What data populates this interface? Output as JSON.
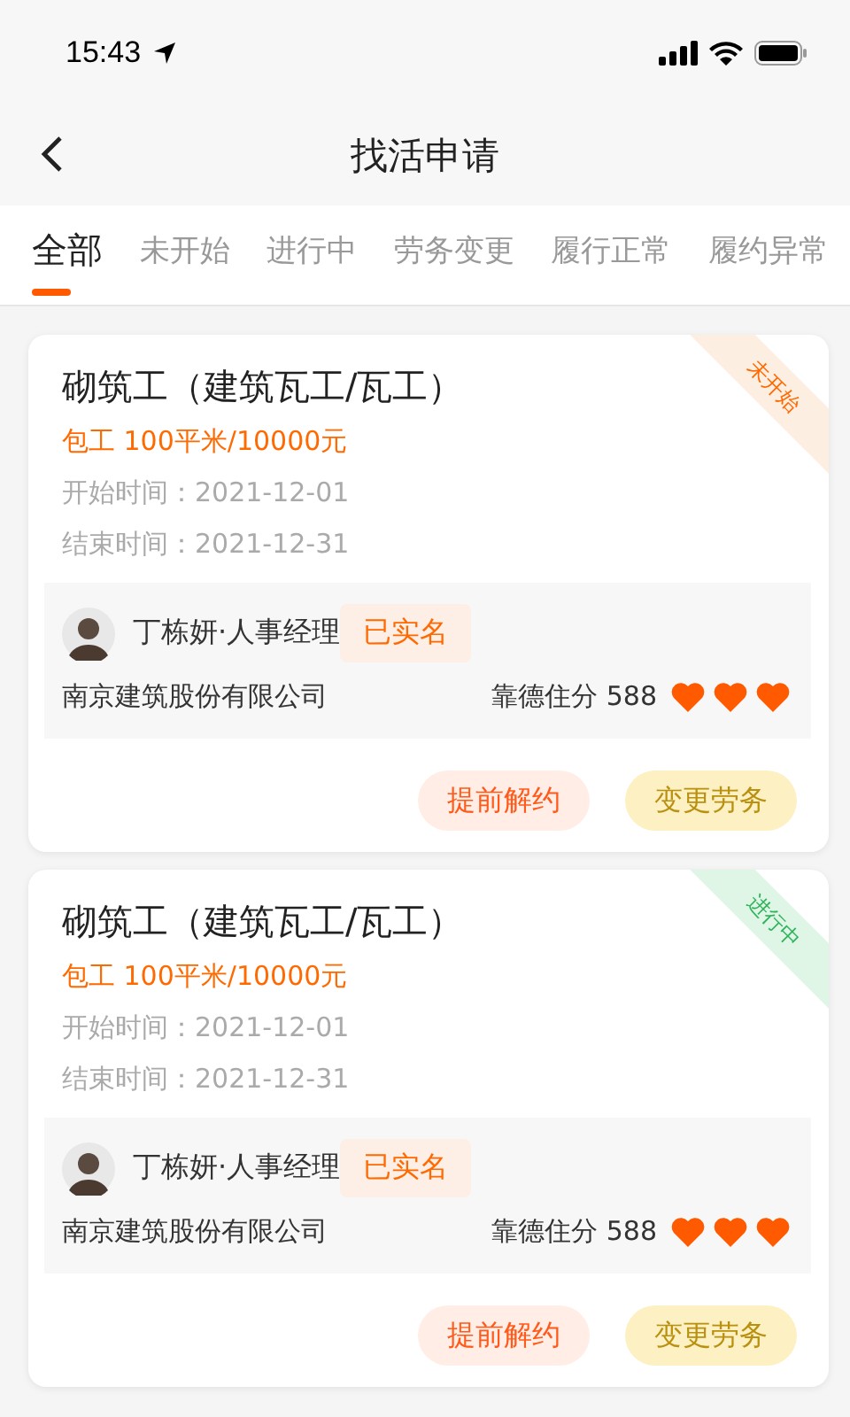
{
  "status_bar": {
    "time": "15:43"
  },
  "nav": {
    "title": "找活申请"
  },
  "tabs": [
    {
      "label": "全部",
      "selected": true
    },
    {
      "label": "未开始",
      "selected": false
    },
    {
      "label": "进行中",
      "selected": false
    },
    {
      "label": "劳务变更",
      "selected": false
    },
    {
      "label": "履行正常",
      "selected": false
    },
    {
      "label": "履约异常",
      "selected": false
    }
  ],
  "cards": [
    {
      "title": "砌筑工（建筑瓦工/瓦工）",
      "price": "包工 100平米/10000元",
      "start": "开始时间：2021-12-01",
      "end": "结束时间：2021-12-31",
      "status": {
        "label": "未开始",
        "kind": "pending"
      },
      "contact": "丁栋妍·人事经理",
      "badge": "已实名",
      "company": "南京建筑股份有限公司",
      "score": "靠德住分 588",
      "stars": 3,
      "buttons": [
        {
          "label": "提前解约",
          "kind": "terminate"
        },
        {
          "label": "变更劳务",
          "kind": "change"
        }
      ]
    },
    {
      "title": "砌筑工（建筑瓦工/瓦工）",
      "price": "包工 100平米/10000元",
      "start": "开始时间：2021-12-01",
      "end": "结束时间：2021-12-31",
      "status": {
        "label": "进行中",
        "kind": "active"
      },
      "contact": "丁栋妍·人事经理",
      "badge": "已实名",
      "company": "南京建筑股份有限公司",
      "score": "靠德住分 588",
      "stars": 3,
      "buttons": [
        {
          "label": "提前解约",
          "kind": "terminate"
        },
        {
          "label": "变更劳务",
          "kind": "change"
        }
      ]
    }
  ]
}
